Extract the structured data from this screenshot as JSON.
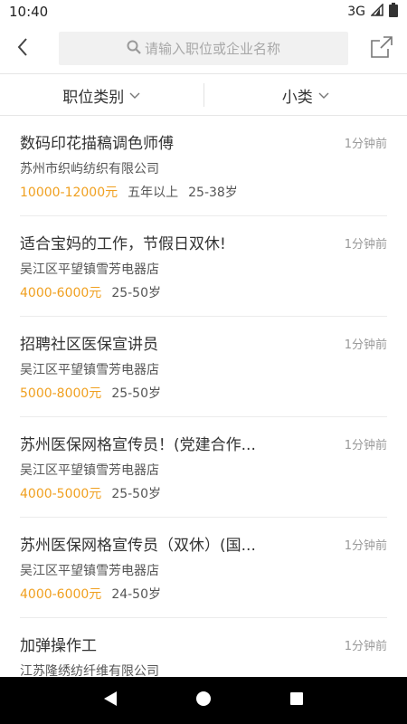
{
  "status_bar": {
    "time": "10:40",
    "network": "3G"
  },
  "search": {
    "placeholder": "请输入职位或企业名称"
  },
  "filters": [
    {
      "label": "职位类别"
    },
    {
      "label": "小类"
    }
  ],
  "jobs": [
    {
      "title": "数码印花描稿调色师傅",
      "time": "1分钟前",
      "company": "苏州市织屿纺织有限公司",
      "salary": "10000-12000元",
      "experience": "五年以上",
      "age": "25-38岁"
    },
    {
      "title": "适合宝妈的工作，节假日双休!",
      "time": "1分钟前",
      "company": "吴江区平望镇雪芳电器店",
      "salary": "4000-6000元",
      "experience": "",
      "age": "25-50岁"
    },
    {
      "title": "招聘社区医保宣讲员",
      "time": "1分钟前",
      "company": "吴江区平望镇雪芳电器店",
      "salary": "5000-8000元",
      "experience": "",
      "age": "25-50岁"
    },
    {
      "title": "苏州医保网格宣传员！(党建合作...",
      "time": "1分钟前",
      "company": "吴江区平望镇雪芳电器店",
      "salary": "4000-5000元",
      "experience": "",
      "age": "25-50岁"
    },
    {
      "title": "苏州医保网格宣传员（双休）(国...",
      "time": "1分钟前",
      "company": "吴江区平望镇雪芳电器店",
      "salary": "4000-6000元",
      "experience": "",
      "age": "24-50岁"
    },
    {
      "title": "加弹操作工",
      "time": "1分钟前",
      "company": "江苏隆绣纺纤维有限公司",
      "salary": "",
      "experience": "",
      "age": ""
    }
  ],
  "colors": {
    "salary": "#f0a020",
    "accent_text": "#333333",
    "muted": "#999999"
  },
  "icons": {
    "back": "chevron-left-icon",
    "search": "search-icon",
    "share": "share-icon",
    "filter_arrow": "chevron-down-icon"
  }
}
